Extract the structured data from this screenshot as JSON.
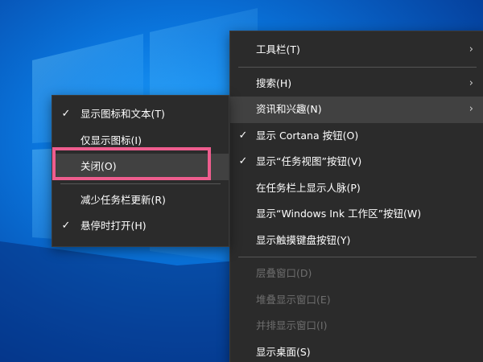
{
  "colors": {
    "menu_bg": "#2b2b2b",
    "hover_bg": "#414141",
    "disabled_text": "#6e6e6e",
    "highlight_border": "#ee5d8e",
    "desktop_blue": "#0a78e0"
  },
  "main_menu": {
    "toolbars": {
      "label": "工具栏(T)",
      "icon": "chevron-right-icon"
    },
    "search": {
      "label": "搜索(H)",
      "icon": "chevron-right-icon"
    },
    "news_interests": {
      "label": "资讯和兴趣(N)",
      "icon": "chevron-right-icon",
      "state": "hovered"
    },
    "cortana": {
      "label": "显示 Cortana 按钮(O)",
      "checked": true
    },
    "task_view": {
      "label": "显示“任务视图”按钮(V)",
      "checked": true
    },
    "people": {
      "label": "在任务栏上显示人脉(P)"
    },
    "windows_ink": {
      "label": "显示“Windows Ink 工作区”按钮(W)"
    },
    "touch_keyboard": {
      "label": "显示触摸键盘按钮(Y)"
    },
    "cascade": {
      "label": "层叠窗口(D)",
      "disabled": true
    },
    "stacked": {
      "label": "堆叠显示窗口(E)",
      "disabled": true
    },
    "side_by_side": {
      "label": "并排显示窗口(I)",
      "disabled": true
    },
    "show_desktop": {
      "label": "显示桌面(S)"
    }
  },
  "sub_menu": {
    "icon_and_text": {
      "label": "显示图标和文本(T)",
      "checked": true
    },
    "icon_only": {
      "label": "仅显示图标(I)"
    },
    "close": {
      "label": "关闭(O)",
      "state": "hovered",
      "annotated": true
    },
    "reduce_updates": {
      "label": "减少任务栏更新(R)"
    },
    "open_on_hover": {
      "label": "悬停时打开(H)",
      "checked": true
    }
  },
  "glyphs": {
    "check": "✓",
    "chevron": "›"
  }
}
